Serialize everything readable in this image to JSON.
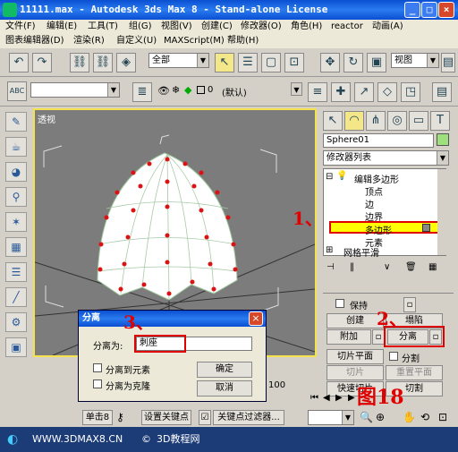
{
  "window": {
    "title": "11111.max - Autodesk 3ds Max 8 - Stand-alone License",
    "min": "_",
    "max": "□",
    "close": "×"
  },
  "menu": {
    "row1": [
      "文件(F)",
      "编辑(E)",
      "工具(T)",
      "组(G)",
      "视图(V)",
      "创建(C)",
      "修改器(O)",
      "角色(H)",
      "reactor",
      "动画(A)"
    ],
    "row2": [
      "图表编辑器(D)",
      "渲染(R)",
      "自定义(U)",
      "MAXScript(M)",
      "帮助(H)"
    ]
  },
  "toolbar": {
    "selection_filter": "全部",
    "ref_coord": "视图",
    "layer_name": "(默认)",
    "layer_index": "0"
  },
  "viewport": {
    "label": "透视"
  },
  "command_panel": {
    "object_name": "Sphere01",
    "modifier_list": "修改器列表",
    "stack": {
      "edit_poly": "编辑多边形",
      "sub_items": [
        "顶点",
        "边",
        "边界",
        "多边形",
        "元素"
      ],
      "selected": "多边形",
      "below": "网格平滑"
    },
    "geometry": {
      "keep_label": "保持",
      "create": "创建",
      "collapse": "塌陷",
      "attach": "附加",
      "detach": "分离",
      "slice_plane": "切片平面",
      "split": "分割",
      "slice": "切片",
      "reset_plane": "重置平面",
      "quickslice": "快速切片",
      "cut": "切割"
    }
  },
  "detach_dialog": {
    "title": "分离",
    "detach_as_label": "分离为:",
    "detach_as_value": "刺座",
    "to_element": "分离到元素",
    "as_clone": "分离为克隆",
    "ok": "确定",
    "cancel": "取消"
  },
  "annotations": {
    "step1": "1、",
    "step2": "2、",
    "step3": "3、",
    "figure": "图18"
  },
  "timeline": {
    "frame_value": "100",
    "key_mode": "单击8",
    "set_key": "设置关键点",
    "key_filters": "关键点过滤器..."
  },
  "footer": {
    "site": "WWW.3DMAX8.CN",
    "copyright": "©",
    "name": "3D教程网"
  },
  "colors": {
    "highlight": "#ffff00",
    "annotation_red": "#e00000",
    "viewport_border": "#f4e34a"
  }
}
